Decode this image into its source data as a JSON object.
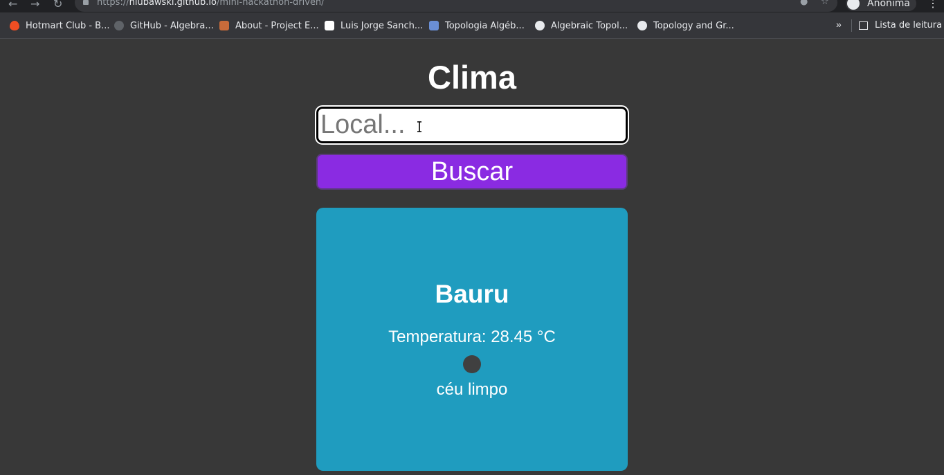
{
  "browser": {
    "url_scheme": "https://",
    "url_host": "nlubawski.github.io",
    "url_path": "/mini-hackathon-driven/",
    "profile_name": "Anônima",
    "bookmarks": [
      {
        "label": "Hotmart Club - B...",
        "icon": "hotmart-icon",
        "color": "#f04e23"
      },
      {
        "label": "GitHub - Algebra...",
        "icon": "github-icon",
        "color": "#24292e"
      },
      {
        "label": "About - Project E...",
        "icon": "project-euler-icon",
        "color": "#c86b3a"
      },
      {
        "label": "Luis Jorge Sanch...",
        "icon": "site-icon",
        "color": "#ffffff"
      },
      {
        "label": "Topologia Algéb...",
        "icon": "site-icon",
        "color": "#6a8fd6"
      },
      {
        "label": "Algebraic Topol...",
        "icon": "globe-icon",
        "color": "#e8eaed"
      },
      {
        "label": "Topology and Gr...",
        "icon": "globe-icon",
        "color": "#e8eaed"
      }
    ],
    "overflow": "»",
    "reading_list": "Lista de leitura"
  },
  "page": {
    "title": "Clima",
    "search_placeholder": "Local...",
    "search_button": "Buscar"
  },
  "weather": {
    "city": "Bauru",
    "temperature": "Temperatura: 28.45 °C",
    "description": "céu limpo"
  },
  "colors": {
    "background": "#383838",
    "button": "#8a2be2",
    "card": "#1f9cbf"
  }
}
